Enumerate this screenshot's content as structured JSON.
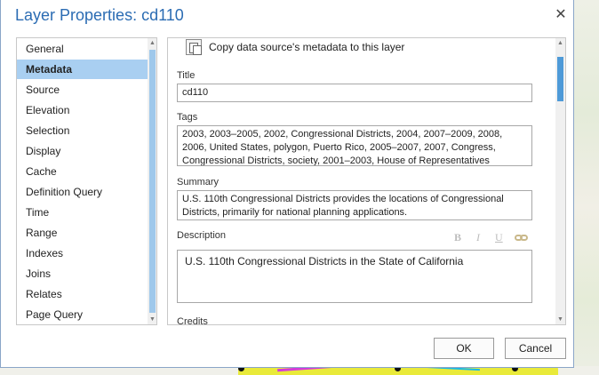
{
  "window": {
    "title": "Layer Properties: cd110",
    "close_glyph": "✕"
  },
  "nav": {
    "items": [
      {
        "label": "General"
      },
      {
        "label": "Metadata",
        "selected": true
      },
      {
        "label": "Source"
      },
      {
        "label": "Elevation"
      },
      {
        "label": "Selection"
      },
      {
        "label": "Display"
      },
      {
        "label": "Cache"
      },
      {
        "label": "Definition Query"
      },
      {
        "label": "Time"
      },
      {
        "label": "Range"
      },
      {
        "label": "Indexes"
      },
      {
        "label": "Joins"
      },
      {
        "label": "Relates"
      },
      {
        "label": "Page Query"
      }
    ]
  },
  "metadata": {
    "copy_label": "Copy data source's metadata to this layer",
    "title_label": "Title",
    "title_value": "cd110",
    "tags_label": "Tags",
    "tags_value": "2003, 2003–2005, 2002, Congressional Districts, 2004, 2007–2009, 2008, 2006, United States, polygon, Puerto Rico, 2005–2007, 2007, Congress, Congressional Districts, society, 2001–2003, House of Representatives",
    "summary_label": "Summary",
    "summary_value": "U.S. 110th Congressional Districts provides the locations of Congressional Districts, primarily for national planning applications.",
    "description_label": "Description",
    "description_value": "U.S. 110th Congressional Districts in the State of California",
    "credits_label": "Credits",
    "format_bold": "B",
    "format_italic": "I",
    "format_underline": "U"
  },
  "buttons": {
    "ok": "OK",
    "cancel": "Cancel"
  },
  "colors": {
    "title_blue": "#2b6cb3",
    "selection": "#a9cff1",
    "scrollbar_thumb": "#4e9ad8"
  }
}
